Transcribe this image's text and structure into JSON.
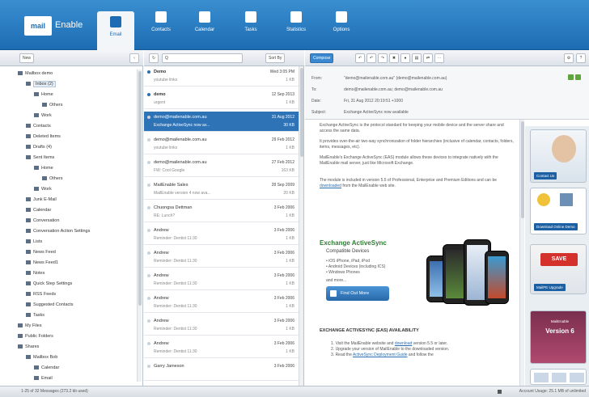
{
  "app": {
    "logo_mark": "mail",
    "logo_text": "Enable"
  },
  "nav": [
    {
      "label": "Email",
      "icon": "envelope-icon",
      "active": true
    },
    {
      "label": "Contacts",
      "icon": "person-icon"
    },
    {
      "label": "Calendar",
      "icon": "calendar-icon"
    },
    {
      "label": "Tasks",
      "icon": "clipboard-icon"
    },
    {
      "label": "Statistics",
      "icon": "bar-chart-icon"
    },
    {
      "label": "Options",
      "icon": "gear-icon"
    }
  ],
  "toolbar": {
    "new_label": "New",
    "search_label": "Q",
    "sort_label": "Sort By",
    "compose_label": "Compose"
  },
  "folders": [
    "Mailbox demo",
    "Inbox (2)",
    "Home",
    "Others",
    "Work",
    "Contacts",
    "Deleted Items",
    "Drafts (4)",
    "Sent Items",
    "Home",
    "Others",
    "Work",
    "Junk E-Mail",
    "Calendar",
    "Conversation",
    "Conversation Action Settings",
    "Lists",
    "News Feed",
    "News Feed1",
    "Notes",
    "Quick Step Settings",
    "RSS Feeds",
    "Suggested Contacts",
    "Tasks",
    "My Files",
    "Public Folders",
    "Shares",
    "Mailbox Bob",
    "Calendar",
    "Email"
  ],
  "messages": [
    {
      "sender": "Demo",
      "date": "Wed 3:05 PM",
      "subject": "youtube links",
      "size": "1 KB",
      "unread": true
    },
    {
      "sender": "demo",
      "date": "12 Sep 2013",
      "subject": "urgent",
      "size": "1 KB",
      "unread": true
    },
    {
      "sender": "demo@mailenable.com.au",
      "date": "31 Aug 2012",
      "subject": "Exchange ActiveSync now av...",
      "size": "30 KB",
      "selected": true
    },
    {
      "sender": "demo@mailenable.com.au",
      "date": "29 Feb 2012",
      "subject": "youtube links",
      "size": "1 KB"
    },
    {
      "sender": "demo@mailenable.com.au",
      "date": "27 Feb 2012",
      "subject": "FW: Cool Google",
      "size": "163 KB"
    },
    {
      "sender": "MailEnable Sales",
      "date": "28 Sep 2009",
      "subject": "MailEnable version 4 now ava...",
      "size": "20 KB"
    },
    {
      "sender": "Chuongsa Dettman",
      "date": "3 Feb 2006",
      "subject": "RE: Lunch?",
      "size": "1 KB"
    },
    {
      "sender": "Andrew",
      "date": "3 Feb 2006",
      "subject": "Reminder: Dentist 11:30",
      "size": "1 KB"
    },
    {
      "sender": "Andrew",
      "date": "3 Feb 2006",
      "subject": "Reminder: Dentist 11:30",
      "size": "1 KB"
    },
    {
      "sender": "Andrew",
      "date": "3 Feb 2006",
      "subject": "Reminder: Dentist 11:30",
      "size": "1 KB"
    },
    {
      "sender": "Andrew",
      "date": "3 Feb 2006",
      "subject": "Reminder: Dentist 11:30",
      "size": "1 KB"
    },
    {
      "sender": "Andrew",
      "date": "3 Feb 2006",
      "subject": "Reminder: Dentist 11:30",
      "size": "1 KB"
    },
    {
      "sender": "Andrew",
      "date": "3 Feb 2006",
      "subject": "Reminder: Dentist 11:30",
      "size": "1 KB"
    },
    {
      "sender": "Garry Jameson",
      "date": "3 Feb 2006",
      "subject": "",
      "size": ""
    }
  ],
  "preview": {
    "from_label": "From:",
    "from_value": "\"demo@mailenable.com.au\" (demo@mailenable.com.au)",
    "to_label": "To:",
    "to_value": "demo@mailenable.com.au; demo@mailenable.com.au",
    "date_label": "Date:",
    "date_value": "Fri, 31 Aug 2012 20:19:51 +1000",
    "subject_label": "Subject:",
    "subject_value": "Exchange ActiveSync now available",
    "para1": "Exchange ActiveSync is the protocol standard for keeping your mobile device and the server share and access the same data.",
    "para2": "It provides over-the-air two-way synchronization of folder hierarchies (inclusive of calendar, contacts, folders, items, messages, etc).",
    "para3": "MailEnable's Exchange ActiveSync (EAS) module allows these devices to integrate natively with the MailEnable mail server, just like Microsoft Exchange.",
    "para4_pre": "The module is included in version 5.5 of Professional, Enterprise and Premium Editions and can be ",
    "para4_link": "downloaded",
    "para4_post": " from the MailEnable web site.",
    "as_title": "Exchange ActiveSync",
    "as_sub": "Compatible Devices",
    "as_b1": "• iOS iPhone, iPad, iPod",
    "as_b2": "• Android Devices (including ICS)",
    "as_b3": "• Windows Phones",
    "as_more": "and more...",
    "find_btn": "Find Out More",
    "eas_head": "EXCHANGE ACTIVESYNC (EAS) AVAILABILITY",
    "eas_1_pre": "Visit the MailEnable website and ",
    "eas_1_link": "download",
    "eas_1_post": " version 5.5 or later.",
    "eas_2": "Upgrade your version of MailEnable to the downloaded version.",
    "eas_3_pre": "Read the ",
    "eas_3_link": "ActiveSync Deployment Guide",
    "eas_3_post": " and follow the"
  },
  "ads": {
    "contact_label": "Contact Us",
    "mobile_label": "Download Online Demo",
    "save_badge": "SAVE",
    "upgrade_label": "MailPE Upgrade",
    "version_brand": "MailEnable",
    "version_label": "Version 6"
  },
  "status": {
    "left": "1-25 of 32 Messages  (273.2 kb used)",
    "right": "Account Usage: 25.1 MB of unlimited"
  },
  "colors": {
    "nav_bg": "#1d6cb3",
    "selected_row": "#2f73b7",
    "accent_green": "#2f7d32"
  }
}
